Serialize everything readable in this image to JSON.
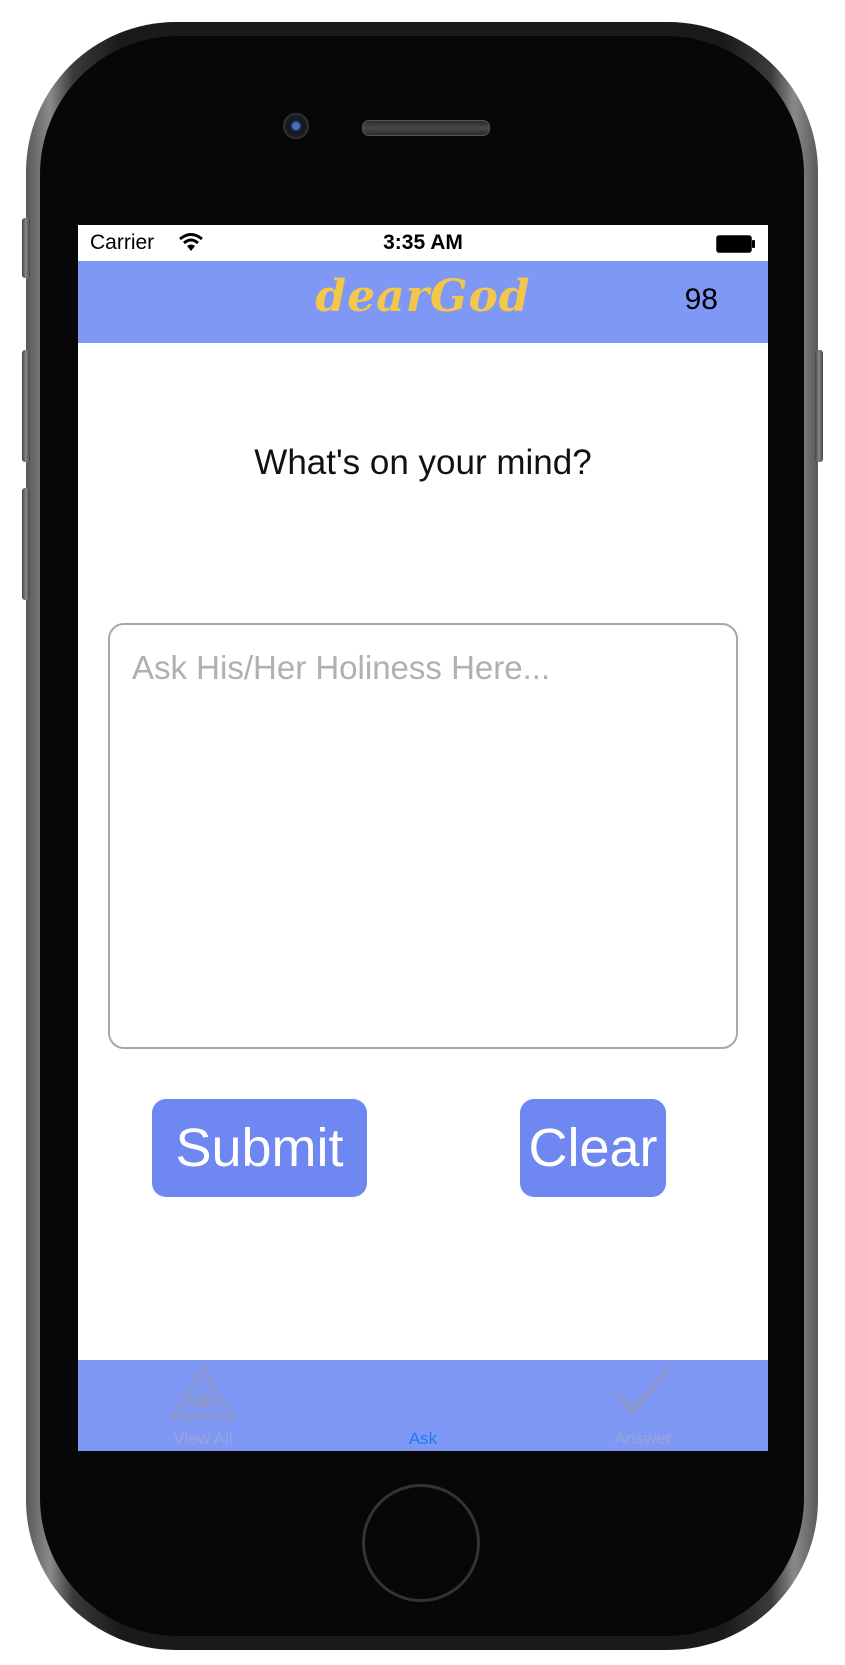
{
  "status_bar": {
    "carrier": "Carrier",
    "time": "3:35 AM"
  },
  "nav": {
    "logo": "dearGod",
    "counter": "98"
  },
  "main": {
    "prompt": "What's on your mind?",
    "question_placeholder": "Ask His/Her Holiness Here...",
    "submit_label": "Submit",
    "clear_label": "Clear"
  },
  "tabs": [
    {
      "label": "View All",
      "icon": "eye-triangle-icon",
      "selected": false
    },
    {
      "label": "Ask",
      "icon": "none",
      "selected": true
    },
    {
      "label": "Answer",
      "icon": "checkmark-icon",
      "selected": false
    }
  ],
  "colors": {
    "bar_blue": "#7f97f5",
    "button_blue": "#6f87f0",
    "logo_gold": "#f2c74a",
    "tab_selected": "#1a7cf5",
    "tab_unselected": "#9aa6d8"
  }
}
